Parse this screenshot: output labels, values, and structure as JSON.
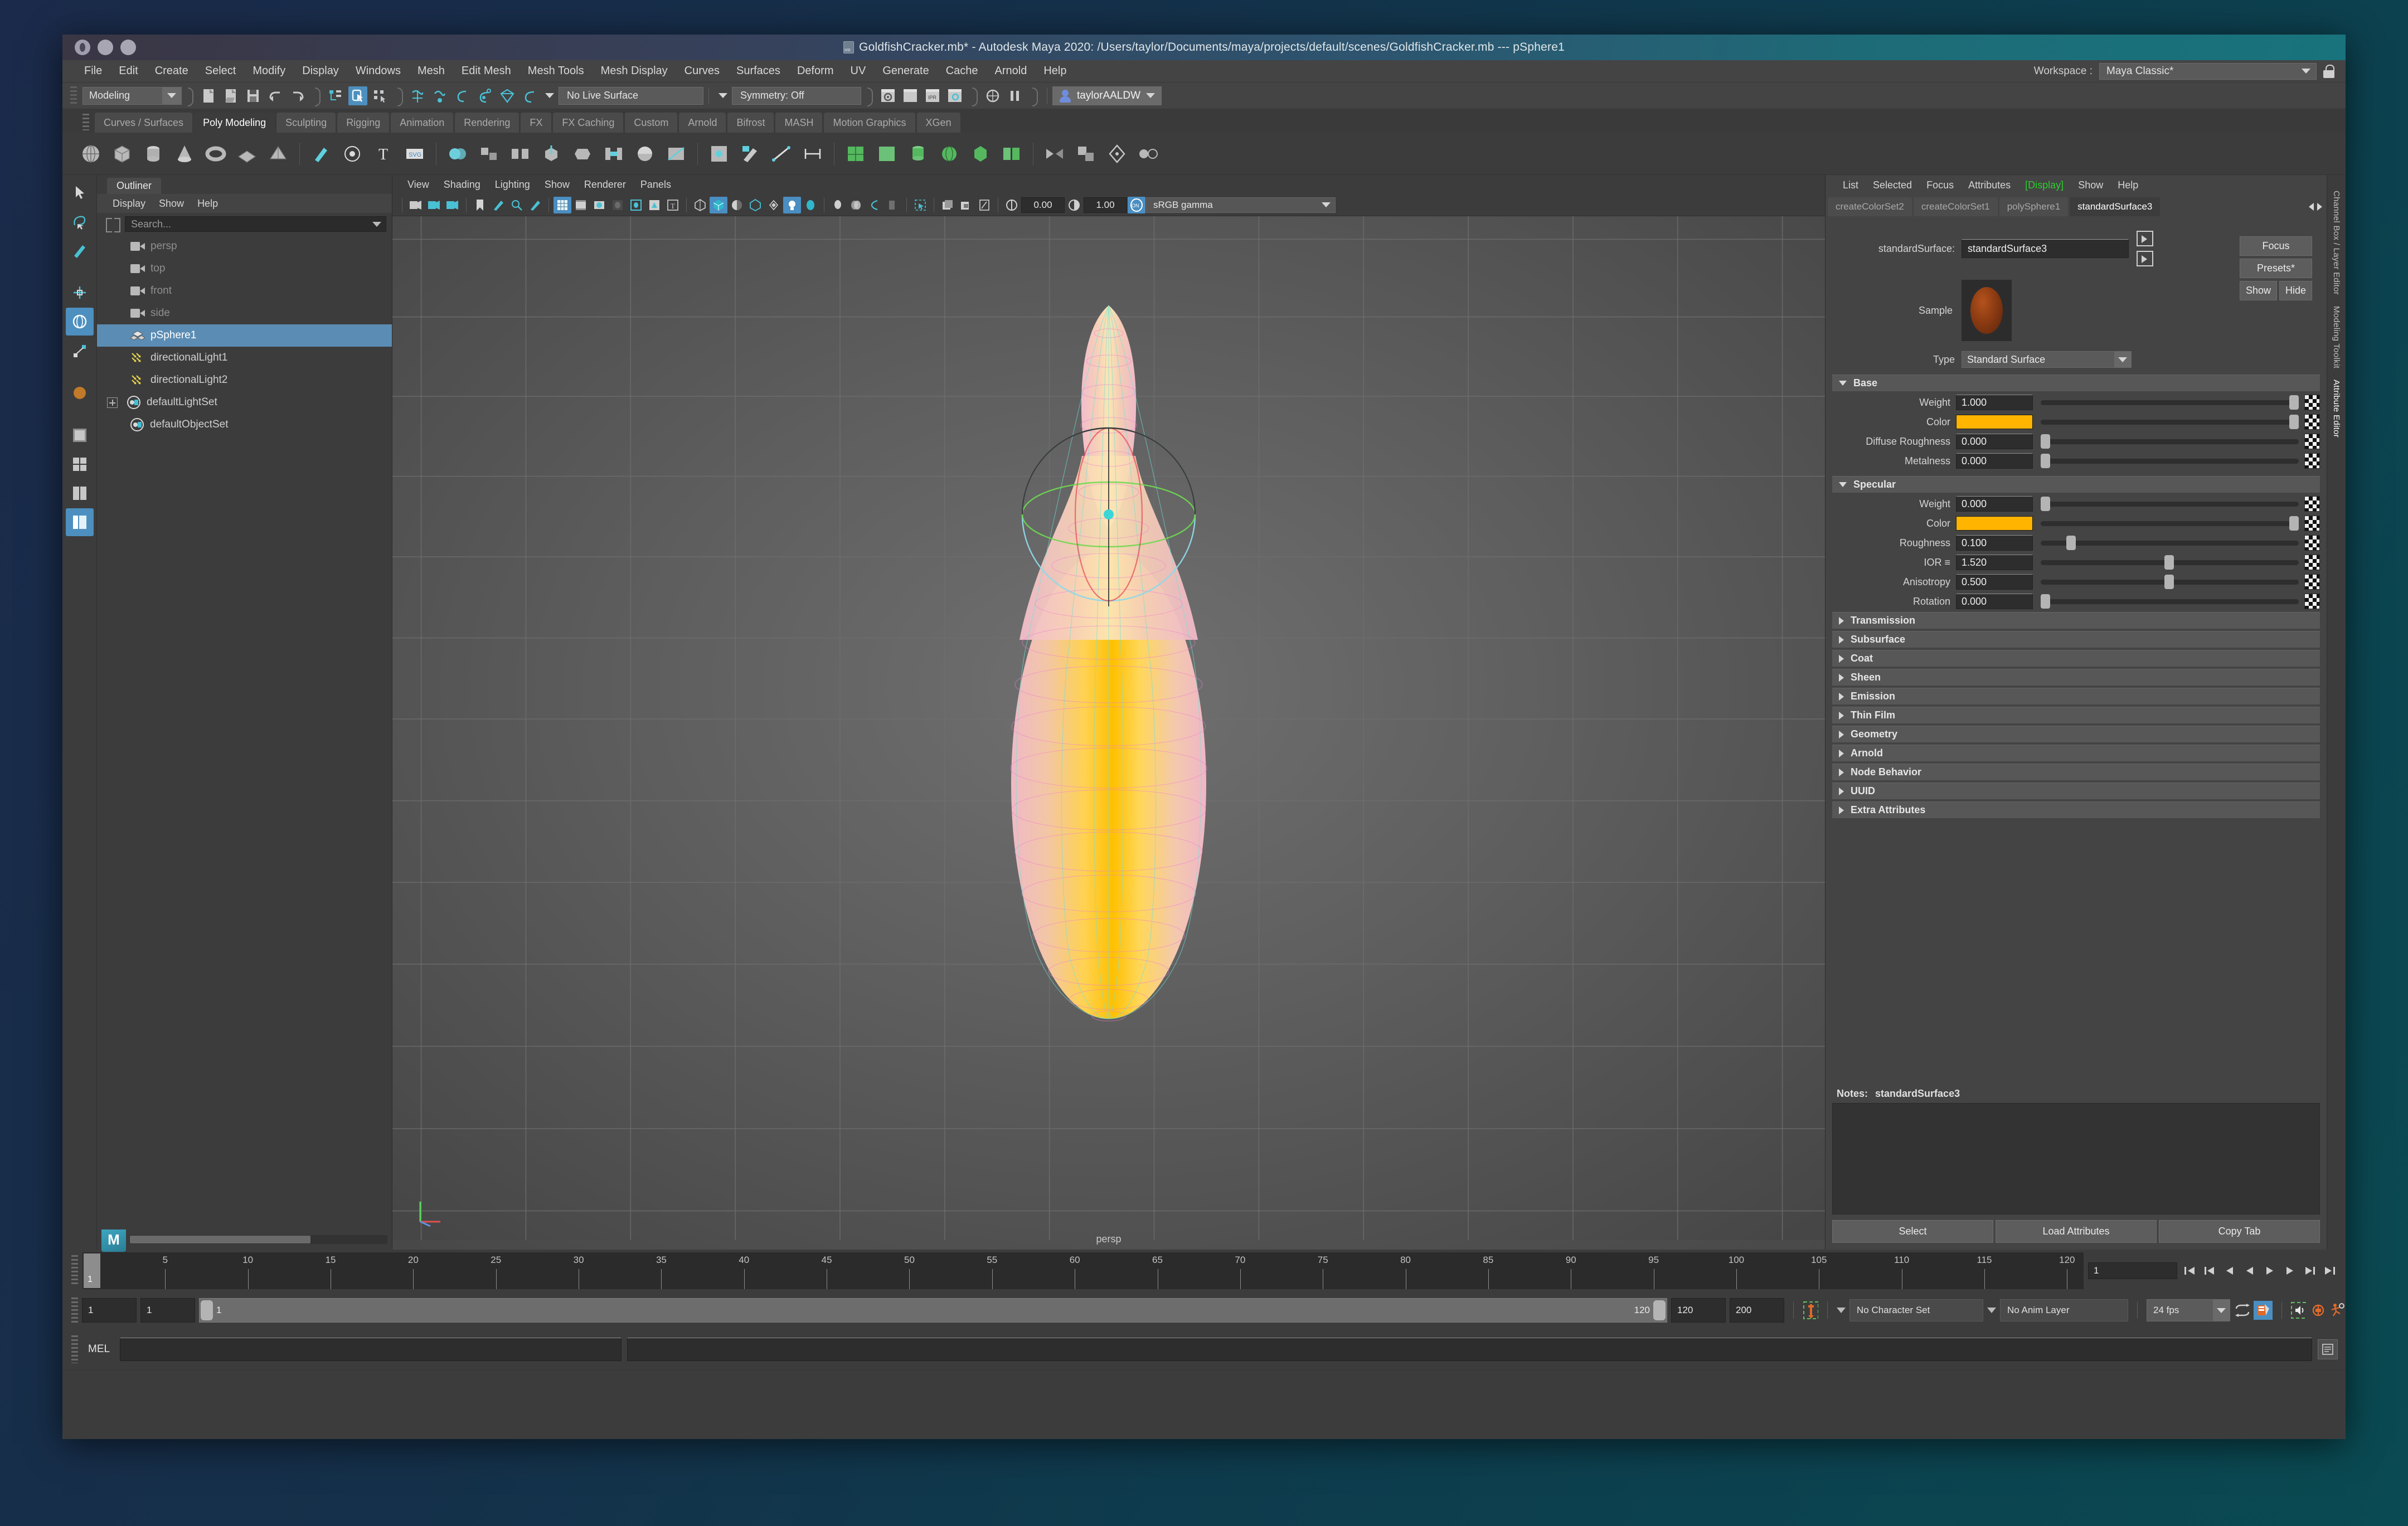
{
  "window": {
    "title": "GoldfishCracker.mb* - Autodesk Maya 2020: /Users/taylor/Documents/maya/projects/default/scenes/GoldfishCracker.mb  ---  pSphere1",
    "doc_icon": "maya-binary-file-icon"
  },
  "menubar": {
    "items": [
      "File",
      "Edit",
      "Create",
      "Select",
      "Modify",
      "Display",
      "Windows",
      "Mesh",
      "Edit Mesh",
      "Mesh Tools",
      "Mesh Display",
      "Curves",
      "Surfaces",
      "Deform",
      "UV",
      "Generate",
      "Cache",
      "Arnold",
      "Help"
    ],
    "workspace_label": "Workspace :",
    "workspace_value": "Maya Classic*"
  },
  "statusline": {
    "mode": "Modeling",
    "live_surface": "No Live Surface",
    "symmetry": "Symmetry: Off",
    "user": "taylorAALDW"
  },
  "shelf": {
    "tabs": [
      "Curves / Surfaces",
      "Poly Modeling",
      "Sculpting",
      "Rigging",
      "Animation",
      "Rendering",
      "FX",
      "FX Caching",
      "Custom",
      "Arnold",
      "Bifrost",
      "MASH",
      "Motion Graphics",
      "XGen"
    ],
    "active_tab": "Poly Modeling"
  },
  "outliner": {
    "tab_label": "Outliner",
    "menu": [
      "Display",
      "Show",
      "Help"
    ],
    "search_placeholder": "Search...",
    "items": [
      {
        "label": "persp",
        "icon": "camera-icon",
        "kind": "camera",
        "dim": true,
        "selected": false,
        "expandable": false
      },
      {
        "label": "top",
        "icon": "camera-icon",
        "kind": "camera",
        "dim": true,
        "selected": false,
        "expandable": false
      },
      {
        "label": "front",
        "icon": "camera-icon",
        "kind": "camera",
        "dim": true,
        "selected": false,
        "expandable": false
      },
      {
        "label": "side",
        "icon": "camera-icon",
        "kind": "camera",
        "dim": true,
        "selected": false,
        "expandable": false
      },
      {
        "label": "pSphere1",
        "icon": "mesh-icon",
        "kind": "mesh",
        "dim": false,
        "selected": true,
        "expandable": false
      },
      {
        "label": "directionalLight1",
        "icon": "directional-light-icon",
        "kind": "light",
        "dim": false,
        "selected": false,
        "expandable": false
      },
      {
        "label": "directionalLight2",
        "icon": "directional-light-icon",
        "kind": "light",
        "dim": false,
        "selected": false,
        "expandable": false
      },
      {
        "label": "defaultLightSet",
        "icon": "set-icon",
        "kind": "set",
        "dim": false,
        "selected": false,
        "expandable": true
      },
      {
        "label": "defaultObjectSet",
        "icon": "set-icon",
        "kind": "set",
        "dim": false,
        "selected": false,
        "expandable": false
      }
    ]
  },
  "viewport": {
    "menu": [
      "View",
      "Shading",
      "Lighting",
      "Show",
      "Renderer",
      "Panels"
    ],
    "exposure": "0.00",
    "gamma": "1.00",
    "color_mgmt_toggle": "ON",
    "color_profile": "sRGB gamma",
    "camera_label": "persp"
  },
  "attribute_editor": {
    "menu": [
      "List",
      "Selected",
      "Focus",
      "Attributes",
      "[Display]",
      "Show",
      "Help"
    ],
    "display_menu_active": "[Display]",
    "tabs": [
      "createColorSet2",
      "createColorSet1",
      "polySphere1",
      "standardSurface3"
    ],
    "active_tab": "standardSurface3",
    "node_type_label": "standardSurface:",
    "node_name": "standardSurface3",
    "buttons": {
      "focus": "Focus",
      "presets": "Presets*",
      "show": "Show",
      "hide": "Hide"
    },
    "sample_label": "Sample",
    "type_label": "Type",
    "type_value": "Standard Surface",
    "sections": [
      {
        "title": "Base",
        "expanded": true,
        "attrs": [
          {
            "label": "Weight",
            "value": "1.000",
            "slider": 1.0,
            "kind": "number"
          },
          {
            "label": "Color",
            "value": "",
            "swatch": "#ffb400",
            "slider": 1.0,
            "kind": "color"
          },
          {
            "label": "Diffuse Roughness",
            "value": "0.000",
            "slider": 0.0,
            "kind": "number"
          },
          {
            "label": "Metalness",
            "value": "0.000",
            "slider": 0.0,
            "kind": "number"
          }
        ]
      },
      {
        "title": "Specular",
        "expanded": true,
        "attrs": [
          {
            "label": "Weight",
            "value": "0.000",
            "slider": 0.0,
            "kind": "number"
          },
          {
            "label": "Color",
            "value": "",
            "swatch": "#ffb400",
            "slider": 1.0,
            "kind": "color"
          },
          {
            "label": "Roughness",
            "value": "0.100",
            "slider": 0.1,
            "kind": "number"
          },
          {
            "label": "IOR ≡",
            "value": "1.520",
            "slider": 0.5,
            "kind": "number"
          },
          {
            "label": "Anisotropy",
            "value": "0.500",
            "slider": 0.5,
            "kind": "number"
          },
          {
            "label": "Rotation",
            "value": "0.000",
            "slider": 0.0,
            "kind": "number"
          }
        ]
      }
    ],
    "collapsed_sections": [
      "Transmission",
      "Subsurface",
      "Coat",
      "Sheen",
      "Emission",
      "Thin Film",
      "Geometry",
      "Arnold",
      "Node Behavior",
      "UUID",
      "Extra Attributes"
    ],
    "notes_label": "Notes:",
    "notes_node": "standardSurface3",
    "notes_value": "",
    "footer_buttons": [
      "Select",
      "Load Attributes",
      "Copy Tab"
    ]
  },
  "right_strip": {
    "tabs": [
      "Channel Box / Layer Editor",
      "Modeling Toolkit",
      "Attribute Editor"
    ]
  },
  "timeline": {
    "ticks": [
      5,
      10,
      15,
      20,
      25,
      30,
      35,
      40,
      45,
      50,
      55,
      60,
      65,
      70,
      75,
      80,
      85,
      90,
      95,
      100,
      105,
      110,
      115,
      120
    ],
    "current_frame": "1",
    "current_frame_field": "1",
    "anim_start": "1",
    "anim_end": "120",
    "range_start": "1",
    "range_end": "120",
    "playback_end": "120",
    "range_max": "200",
    "character_set": "No Character Set",
    "anim_layer": "No Anim Layer",
    "fps": "24 fps"
  },
  "command_line": {
    "language": "MEL",
    "input_value": "",
    "output_value": ""
  },
  "colors": {
    "accent_blue": "#4d8fbf",
    "select_blue": "#5b8db4",
    "teal_icon": "#49c1d4",
    "base_color": "#ffb400",
    "green_menu": "#2ecb2e",
    "panel_bg": "#3c3c3c",
    "ae_bg": "#444444"
  }
}
